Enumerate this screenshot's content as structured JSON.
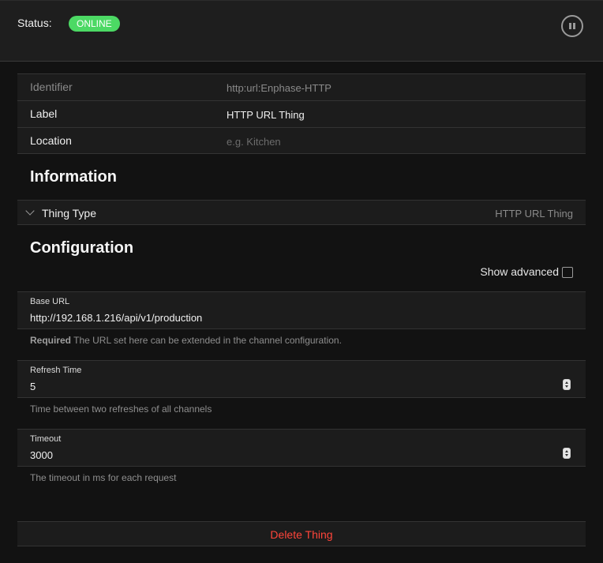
{
  "status": {
    "label": "Status:",
    "badge": "ONLINE",
    "badge_color": "#4cd964"
  },
  "header": {
    "pause_icon": "pause-circle-icon"
  },
  "properties": [
    {
      "label": "Identifier",
      "value": "http:url:Enphase-HTTP"
    },
    {
      "label": "Label",
      "value": "HTTP URL Thing"
    },
    {
      "label": "Location",
      "placeholder": "e.g. Kitchen"
    }
  ],
  "information": {
    "title": "Information",
    "thing_type_label": "Thing Type",
    "thing_type_value": "HTTP URL Thing"
  },
  "configuration": {
    "title": "Configuration",
    "show_advanced_label": "Show advanced",
    "fields": [
      {
        "label": "Base URL",
        "value": "http://192.168.1.216/api/v1/production",
        "hint_required": "Required",
        "hint": " The URL set here can be extended in the channel configuration."
      },
      {
        "label": "Refresh Time",
        "value": "5",
        "hint": "Time between two refreshes of all channels"
      },
      {
        "label": "Timeout",
        "value": "3000",
        "hint": "The timeout in ms for each request"
      }
    ]
  },
  "delete_label": "Delete Thing",
  "colors": {
    "danger": "#ff453a",
    "background": "#121212"
  }
}
